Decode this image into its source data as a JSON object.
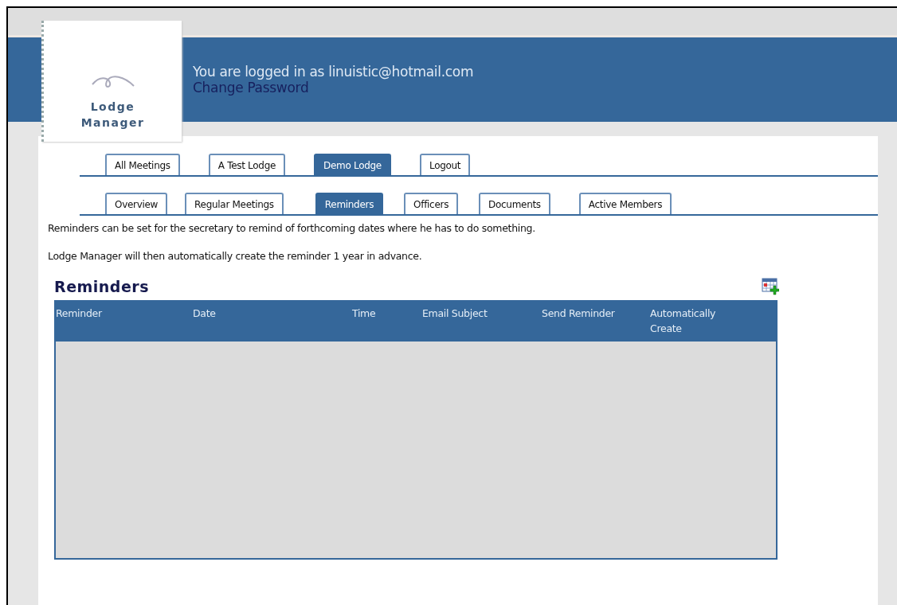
{
  "logo": {
    "line1": "Lodge",
    "line2": "Manager"
  },
  "header": {
    "login_text": "You are logged in as linuistic@hotmail.com",
    "change_password": "Change Password"
  },
  "main_tabs": [
    {
      "label": "All Meetings",
      "selected": false
    },
    {
      "label": "A Test Lodge",
      "selected": false
    },
    {
      "label": "Demo Lodge",
      "selected": true
    },
    {
      "label": "Logout",
      "selected": false
    }
  ],
  "sub_tabs": [
    {
      "label": "Overview",
      "selected": false
    },
    {
      "label": "Regular Meetings",
      "selected": false
    },
    {
      "label": "Reminders",
      "selected": true
    },
    {
      "label": "Officers",
      "selected": false
    },
    {
      "label": "Documents",
      "selected": false
    },
    {
      "label": "Active Members",
      "selected": false
    }
  ],
  "intro": [
    "Reminders can be set for the secretary to remind of forthcoming dates where he has to do something.",
    "Lodge Manager will then automatically create the reminder 1 year in advance."
  ],
  "section_title": "Reminders",
  "table": {
    "columns": [
      "Reminder",
      "Date",
      "Time",
      "Email Subject",
      "Send Reminder",
      "Automatically Create"
    ]
  }
}
